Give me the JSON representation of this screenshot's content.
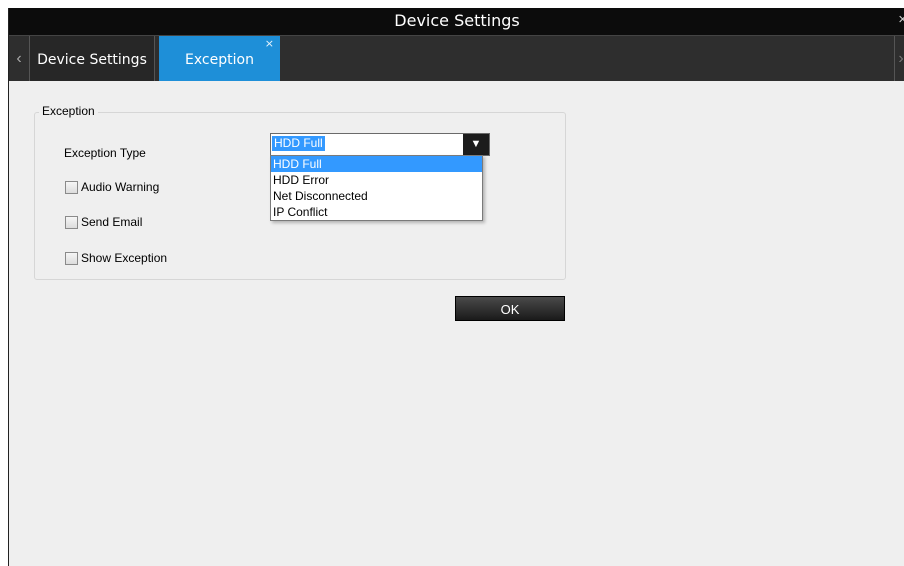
{
  "window": {
    "title": "Device Settings",
    "close_glyph": "×"
  },
  "tabs": {
    "prev_glyph": "‹",
    "next_glyph": "›",
    "items": [
      {
        "label": "Device Settings"
      },
      {
        "label": "Exception",
        "active": true,
        "close_glyph": "×"
      }
    ]
  },
  "exception": {
    "legend": "Exception",
    "type_label": "Exception Type",
    "selected_value": "HDD Full",
    "dropdown_arrow": "▼",
    "options": [
      "HDD Full",
      "HDD Error",
      "Net Disconnected",
      "IP Conflict"
    ],
    "checkboxes": [
      {
        "label": "Audio Warning",
        "checked": false
      },
      {
        "label": "Send Email",
        "checked": false
      },
      {
        "label": "Show Exception",
        "checked": false
      }
    ]
  },
  "ok_label": "OK",
  "colors": {
    "active_tab": "#1e8fd8",
    "selection": "#3399ff",
    "titlebar": "#0c0c0c"
  }
}
